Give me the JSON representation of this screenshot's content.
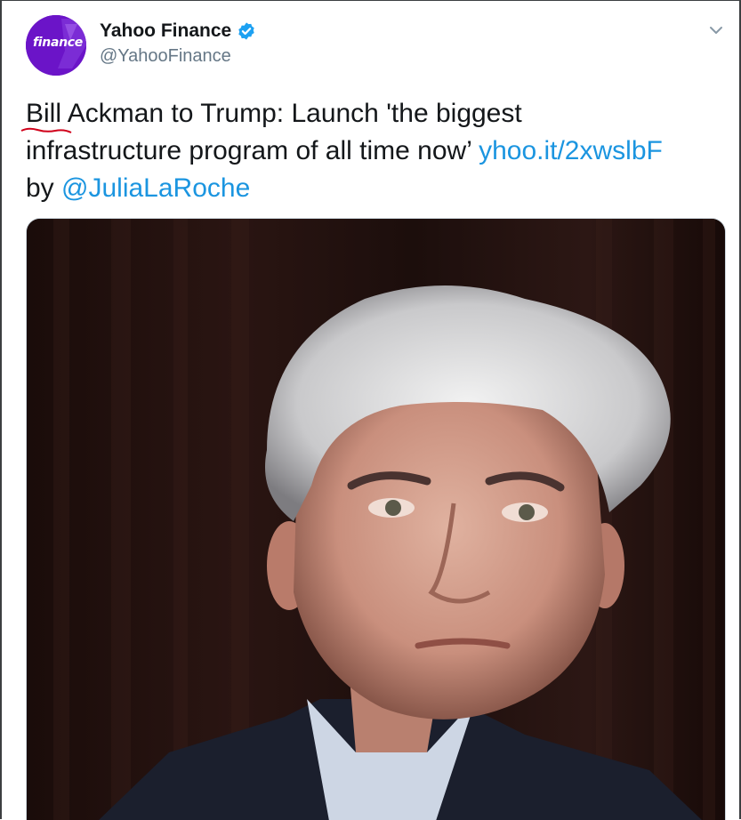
{
  "account": {
    "display_name": "Yahoo Finance",
    "handle": "@YahooFinance",
    "avatar_text": "finance",
    "verified": true,
    "avatar_color": "#6b14c8"
  },
  "tweet": {
    "line1": "Bill Ackman to Trump: Launch 'the biggest",
    "word_bill": "Bill",
    "line1_rest": " Ackman to Trump: Launch 'the biggest",
    "line2_text": "infrastructure program of all time now’ ",
    "link_url": "yhoo.it/2xwslbF",
    "line3_prefix": "by ",
    "mention": "@JuliaLaRoche"
  },
  "colors": {
    "link": "#1b95e0",
    "text": "#14171a",
    "muted": "#657786",
    "verified_badge": "#1da1f2",
    "misspell_underline": "#d0021b"
  },
  "icons": {
    "caret": "chevron-down-icon",
    "verified": "verified-badge-icon"
  },
  "media": {
    "type": "photo"
  }
}
